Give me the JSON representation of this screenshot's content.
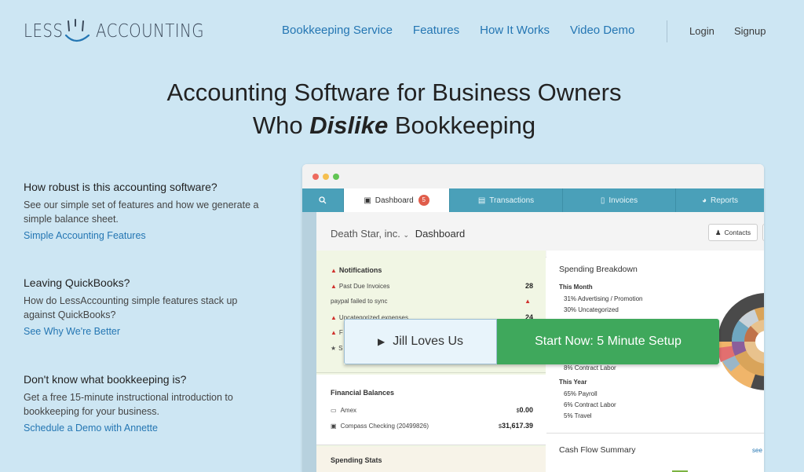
{
  "logo": {
    "left": "LESS",
    "right": "ACCOUNTING"
  },
  "nav": {
    "items": [
      "Bookkeeping Service",
      "Features",
      "How It Works",
      "Video Demo"
    ],
    "login": "Login",
    "signup": "Signup"
  },
  "headline": {
    "line1": "Accounting Software for Business Owners",
    "line2_pre": "Who ",
    "line2_em": "Dislike",
    "line2_post": " Bookkeeping"
  },
  "faq": [
    {
      "q": "How robust is this accounting software?",
      "a": "See our simple set of features and how we generate a simple balance sheet.",
      "link": "Simple Accounting Features"
    },
    {
      "q": "Leaving QuickBooks?",
      "a": "How do LessAccounting simple features stack up against QuickBooks?",
      "link": "See Why We're Better"
    },
    {
      "q": "Don't know what bookkeeping is?",
      "a": "Get a free 15-minute instructional introduction to bookkeeping for your business.",
      "link": "Schedule a Demo with Annette"
    }
  ],
  "app": {
    "tabs": {
      "dashboard": "Dashboard",
      "badge": "5",
      "transactions": "Transactions",
      "invoices": "Invoices",
      "reports": "Reports"
    },
    "company": "Death Star, inc.",
    "page": "Dashboard",
    "contacts": "Contacts",
    "notifications": {
      "title": "Notifications",
      "rows": [
        {
          "label": "Past Due Invoices",
          "value": "28"
        },
        {
          "label": "paypal failed to sync",
          "value": ""
        },
        {
          "label": "Uncategorized expenses",
          "value": "24"
        },
        {
          "label": "F",
          "value": ""
        },
        {
          "label": "S",
          "value": ""
        }
      ]
    },
    "balances": {
      "title": "Financial Balances",
      "rows": [
        {
          "label": "Amex",
          "currency": "$",
          "value": "0.00"
        },
        {
          "label": "Compass Checking (20499826)",
          "currency": "$",
          "value": "31,617.39"
        }
      ]
    },
    "spending_stats": "Spending Stats",
    "breakdown": {
      "title": "Spending Breakdown",
      "this_month": "This Month",
      "month_rows": [
        "31% Advertising / Promotion",
        "30% Uncategorized",
        "8% Contract Labor"
      ],
      "this_year": "This Year",
      "year_rows": [
        "65% Payroll",
        "6% Contract Labor",
        "5% Travel"
      ]
    },
    "cashflow": "Cash Flow Summary",
    "see": "see"
  },
  "cta": {
    "video": "Jill Loves Us",
    "start": "Start Now: 5 Minute Setup"
  },
  "colors": {
    "background": "#cde6f3",
    "link": "#2476b3",
    "tabs": "#4aa0b9",
    "cta_green": "#3fa85c"
  }
}
